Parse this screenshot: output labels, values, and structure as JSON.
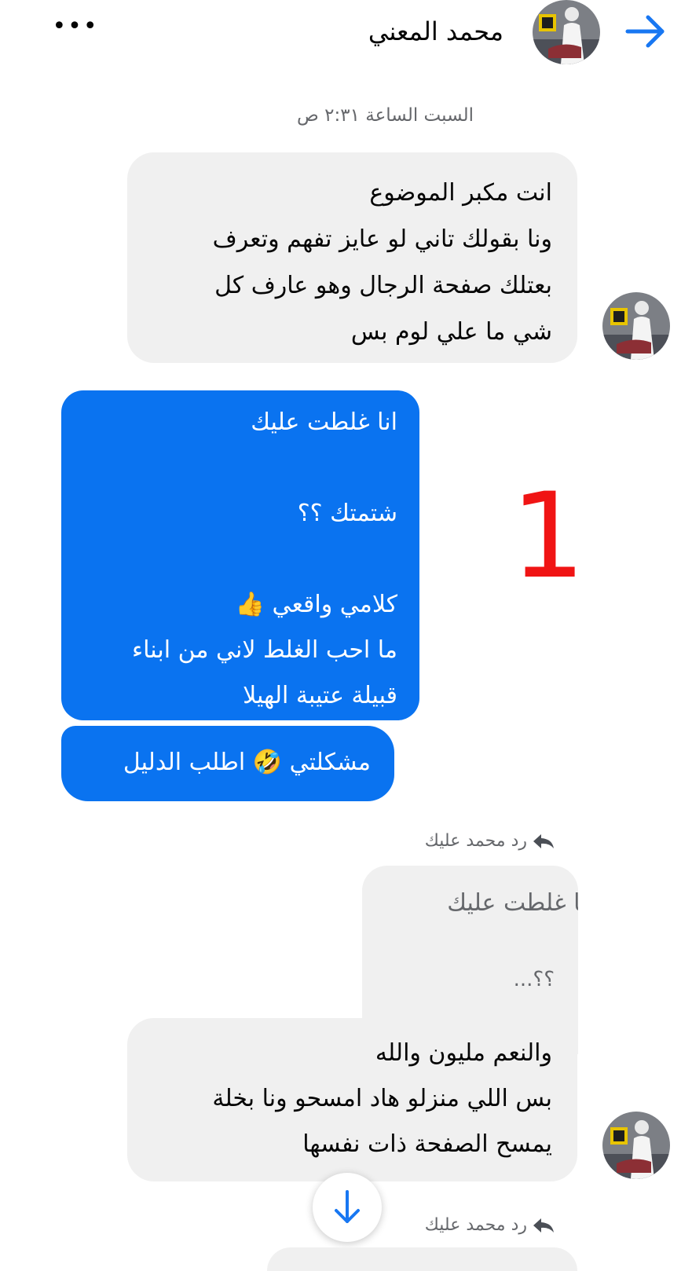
{
  "header": {
    "contact_name": "محمد المعني",
    "more_label": "•••",
    "accent_color": "#1877f2"
  },
  "conversation": {
    "timestamp": "السبت الساعة ٢:٣١ ص",
    "messages": [
      {
        "direction": "incoming",
        "lines": [
          "انت مكبر الموضوع",
          "ونا بقولك تاني لو عايز تفهم وتعرف",
          "بعتلك صفحة الرجال وهو عارف كل",
          "شي ما علي لوم بس"
        ]
      },
      {
        "direction": "outgoing",
        "lines": [
          "انا غلطت عليك",
          "",
          "شتمتك ؟؟",
          "",
          "كلامي واقعي 👍",
          "ما احب الغلط لاني من ابناء",
          "قبيلة عتيبة الهيلا"
        ]
      },
      {
        "direction": "outgoing",
        "lines": [
          "مشكلتي 🤣 اطلب الدليل"
        ]
      },
      {
        "direction": "incoming",
        "reply_label": "رد محمد عليك",
        "quoted_lines": [
          "انا غلطت عليك",
          "؟؟..."
        ],
        "lines": [
          "والنعم مليون والله",
          "بس اللي منزلو هاد امسحو ونا بخلة",
          "يمسح الصفحة ذات نفسها"
        ]
      }
    ],
    "next_reply_label": "رد محمد عليك"
  },
  "annotation": {
    "label": "1",
    "color": "#f01414"
  },
  "colors": {
    "incoming_bubble": "#f0f0f0",
    "outgoing_bubble": "#0a73f0",
    "secondary_text": "#65676b"
  }
}
